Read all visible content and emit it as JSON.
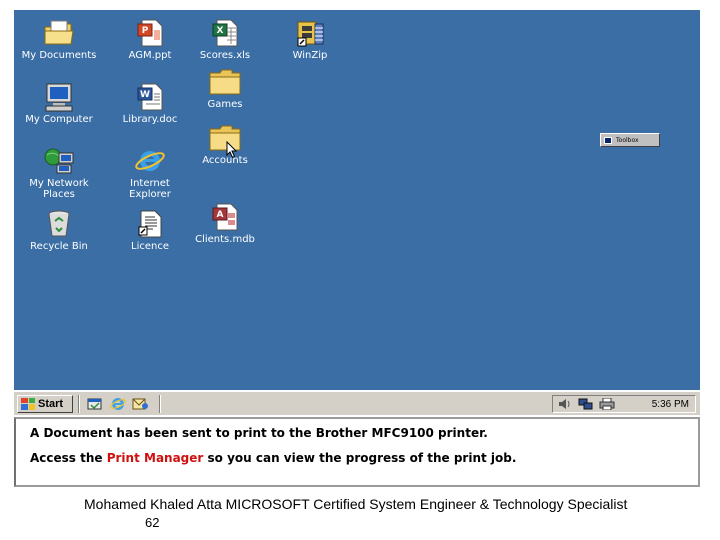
{
  "desktop": {
    "background_color": "#3a6ea5",
    "icons": [
      {
        "label": "My Documents",
        "icon": "my-documents-icon"
      },
      {
        "label": "AGM.ppt",
        "icon": "powerpoint-file-icon"
      },
      {
        "label": "Scores.xls",
        "icon": "excel-file-icon"
      },
      {
        "label": "WinZip",
        "icon": "winzip-icon"
      },
      {
        "label": "Games",
        "icon": "folder-icon"
      },
      {
        "label": "My Computer",
        "icon": "my-computer-icon"
      },
      {
        "label": "Library.doc",
        "icon": "word-file-icon"
      },
      {
        "label": "Accounts",
        "icon": "folder-icon"
      },
      {
        "label": "My Network\nPlaces",
        "icon": "network-places-icon"
      },
      {
        "label": "Internet\nExplorer",
        "icon": "internet-explorer-icon"
      },
      {
        "label": "Recycle Bin",
        "icon": "recycle-bin-icon"
      },
      {
        "label": "Licence",
        "icon": "text-document-icon"
      },
      {
        "label": "Clients.mdb",
        "icon": "access-file-icon"
      }
    ],
    "toolbox_label": "Toolbox"
  },
  "taskbar": {
    "start_label": "Start",
    "quick_launch": [
      "show-desktop-icon",
      "internet-explorer-icon",
      "outlook-express-icon"
    ],
    "tray_icons": [
      "volume-icon",
      "network-icon",
      "printer-icon"
    ],
    "clock": "5:36 PM"
  },
  "message": {
    "line1": "A Document has been sent to print to the Brother MFC9100 printer.",
    "line2_before": "Access the ",
    "line2_highlight": "Print Manager",
    "line2_after": " so you can view the progress of the print job.",
    "highlight_color": "#d01010"
  },
  "footer": {
    "text": "Mohamed Khaled Atta MICROSOFT Certified System Engineer & Technology Specialist",
    "page_number": "62"
  }
}
